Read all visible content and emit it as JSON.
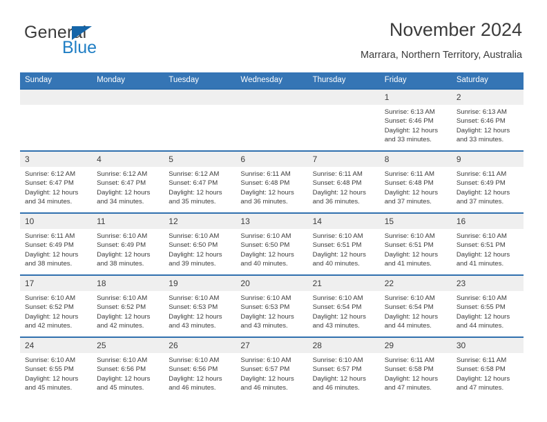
{
  "logo": {
    "word_one": "General",
    "word_two": "Blue",
    "triangle_icon": "triangle-icon",
    "color_dark": "#3b3b3b",
    "color_blue": "#1f7ec4"
  },
  "header": {
    "title": "November 2024",
    "subtitle": "Marrara, Northern Territory, Australia"
  },
  "theme": {
    "header_blue": "#3575b5",
    "row_border_blue": "#2f6fae",
    "daynum_band": "#efefef",
    "text": "#3b3b3b"
  },
  "weekday_headers": [
    "Sunday",
    "Monday",
    "Tuesday",
    "Wednesday",
    "Thursday",
    "Friday",
    "Saturday"
  ],
  "weeks": [
    [
      {
        "day": "",
        "sunrise": "",
        "sunset": "",
        "daylight_line1": "",
        "daylight_line2": ""
      },
      {
        "day": "",
        "sunrise": "",
        "sunset": "",
        "daylight_line1": "",
        "daylight_line2": ""
      },
      {
        "day": "",
        "sunrise": "",
        "sunset": "",
        "daylight_line1": "",
        "daylight_line2": ""
      },
      {
        "day": "",
        "sunrise": "",
        "sunset": "",
        "daylight_line1": "",
        "daylight_line2": ""
      },
      {
        "day": "",
        "sunrise": "",
        "sunset": "",
        "daylight_line1": "",
        "daylight_line2": ""
      },
      {
        "day": "1",
        "sunrise": "Sunrise: 6:13 AM",
        "sunset": "Sunset: 6:46 PM",
        "daylight_line1": "Daylight: 12 hours",
        "daylight_line2": "and 33 minutes."
      },
      {
        "day": "2",
        "sunrise": "Sunrise: 6:13 AM",
        "sunset": "Sunset: 6:46 PM",
        "daylight_line1": "Daylight: 12 hours",
        "daylight_line2": "and 33 minutes."
      }
    ],
    [
      {
        "day": "3",
        "sunrise": "Sunrise: 6:12 AM",
        "sunset": "Sunset: 6:47 PM",
        "daylight_line1": "Daylight: 12 hours",
        "daylight_line2": "and 34 minutes."
      },
      {
        "day": "4",
        "sunrise": "Sunrise: 6:12 AM",
        "sunset": "Sunset: 6:47 PM",
        "daylight_line1": "Daylight: 12 hours",
        "daylight_line2": "and 34 minutes."
      },
      {
        "day": "5",
        "sunrise": "Sunrise: 6:12 AM",
        "sunset": "Sunset: 6:47 PM",
        "daylight_line1": "Daylight: 12 hours",
        "daylight_line2": "and 35 minutes."
      },
      {
        "day": "6",
        "sunrise": "Sunrise: 6:11 AM",
        "sunset": "Sunset: 6:48 PM",
        "daylight_line1": "Daylight: 12 hours",
        "daylight_line2": "and 36 minutes."
      },
      {
        "day": "7",
        "sunrise": "Sunrise: 6:11 AM",
        "sunset": "Sunset: 6:48 PM",
        "daylight_line1": "Daylight: 12 hours",
        "daylight_line2": "and 36 minutes."
      },
      {
        "day": "8",
        "sunrise": "Sunrise: 6:11 AM",
        "sunset": "Sunset: 6:48 PM",
        "daylight_line1": "Daylight: 12 hours",
        "daylight_line2": "and 37 minutes."
      },
      {
        "day": "9",
        "sunrise": "Sunrise: 6:11 AM",
        "sunset": "Sunset: 6:49 PM",
        "daylight_line1": "Daylight: 12 hours",
        "daylight_line2": "and 37 minutes."
      }
    ],
    [
      {
        "day": "10",
        "sunrise": "Sunrise: 6:11 AM",
        "sunset": "Sunset: 6:49 PM",
        "daylight_line1": "Daylight: 12 hours",
        "daylight_line2": "and 38 minutes."
      },
      {
        "day": "11",
        "sunrise": "Sunrise: 6:10 AM",
        "sunset": "Sunset: 6:49 PM",
        "daylight_line1": "Daylight: 12 hours",
        "daylight_line2": "and 38 minutes."
      },
      {
        "day": "12",
        "sunrise": "Sunrise: 6:10 AM",
        "sunset": "Sunset: 6:50 PM",
        "daylight_line1": "Daylight: 12 hours",
        "daylight_line2": "and 39 minutes."
      },
      {
        "day": "13",
        "sunrise": "Sunrise: 6:10 AM",
        "sunset": "Sunset: 6:50 PM",
        "daylight_line1": "Daylight: 12 hours",
        "daylight_line2": "and 40 minutes."
      },
      {
        "day": "14",
        "sunrise": "Sunrise: 6:10 AM",
        "sunset": "Sunset: 6:51 PM",
        "daylight_line1": "Daylight: 12 hours",
        "daylight_line2": "and 40 minutes."
      },
      {
        "day": "15",
        "sunrise": "Sunrise: 6:10 AM",
        "sunset": "Sunset: 6:51 PM",
        "daylight_line1": "Daylight: 12 hours",
        "daylight_line2": "and 41 minutes."
      },
      {
        "day": "16",
        "sunrise": "Sunrise: 6:10 AM",
        "sunset": "Sunset: 6:51 PM",
        "daylight_line1": "Daylight: 12 hours",
        "daylight_line2": "and 41 minutes."
      }
    ],
    [
      {
        "day": "17",
        "sunrise": "Sunrise: 6:10 AM",
        "sunset": "Sunset: 6:52 PM",
        "daylight_line1": "Daylight: 12 hours",
        "daylight_line2": "and 42 minutes."
      },
      {
        "day": "18",
        "sunrise": "Sunrise: 6:10 AM",
        "sunset": "Sunset: 6:52 PM",
        "daylight_line1": "Daylight: 12 hours",
        "daylight_line2": "and 42 minutes."
      },
      {
        "day": "19",
        "sunrise": "Sunrise: 6:10 AM",
        "sunset": "Sunset: 6:53 PM",
        "daylight_line1": "Daylight: 12 hours",
        "daylight_line2": "and 43 minutes."
      },
      {
        "day": "20",
        "sunrise": "Sunrise: 6:10 AM",
        "sunset": "Sunset: 6:53 PM",
        "daylight_line1": "Daylight: 12 hours",
        "daylight_line2": "and 43 minutes."
      },
      {
        "day": "21",
        "sunrise": "Sunrise: 6:10 AM",
        "sunset": "Sunset: 6:54 PM",
        "daylight_line1": "Daylight: 12 hours",
        "daylight_line2": "and 43 minutes."
      },
      {
        "day": "22",
        "sunrise": "Sunrise: 6:10 AM",
        "sunset": "Sunset: 6:54 PM",
        "daylight_line1": "Daylight: 12 hours",
        "daylight_line2": "and 44 minutes."
      },
      {
        "day": "23",
        "sunrise": "Sunrise: 6:10 AM",
        "sunset": "Sunset: 6:55 PM",
        "daylight_line1": "Daylight: 12 hours",
        "daylight_line2": "and 44 minutes."
      }
    ],
    [
      {
        "day": "24",
        "sunrise": "Sunrise: 6:10 AM",
        "sunset": "Sunset: 6:55 PM",
        "daylight_line1": "Daylight: 12 hours",
        "daylight_line2": "and 45 minutes."
      },
      {
        "day": "25",
        "sunrise": "Sunrise: 6:10 AM",
        "sunset": "Sunset: 6:56 PM",
        "daylight_line1": "Daylight: 12 hours",
        "daylight_line2": "and 45 minutes."
      },
      {
        "day": "26",
        "sunrise": "Sunrise: 6:10 AM",
        "sunset": "Sunset: 6:56 PM",
        "daylight_line1": "Daylight: 12 hours",
        "daylight_line2": "and 46 minutes."
      },
      {
        "day": "27",
        "sunrise": "Sunrise: 6:10 AM",
        "sunset": "Sunset: 6:57 PM",
        "daylight_line1": "Daylight: 12 hours",
        "daylight_line2": "and 46 minutes."
      },
      {
        "day": "28",
        "sunrise": "Sunrise: 6:10 AM",
        "sunset": "Sunset: 6:57 PM",
        "daylight_line1": "Daylight: 12 hours",
        "daylight_line2": "and 46 minutes."
      },
      {
        "day": "29",
        "sunrise": "Sunrise: 6:11 AM",
        "sunset": "Sunset: 6:58 PM",
        "daylight_line1": "Daylight: 12 hours",
        "daylight_line2": "and 47 minutes."
      },
      {
        "day": "30",
        "sunrise": "Sunrise: 6:11 AM",
        "sunset": "Sunset: 6:58 PM",
        "daylight_line1": "Daylight: 12 hours",
        "daylight_line2": "and 47 minutes."
      }
    ]
  ]
}
